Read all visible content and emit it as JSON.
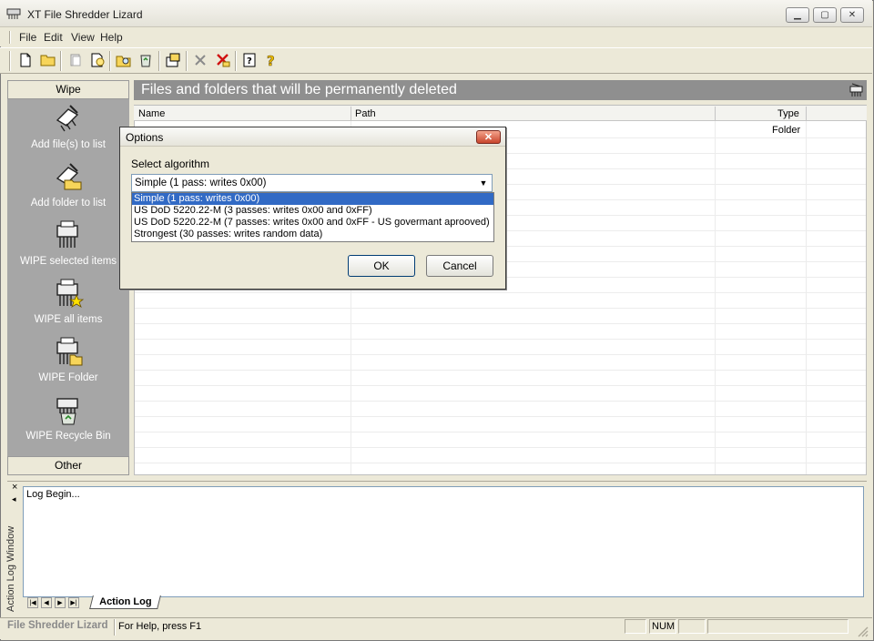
{
  "window": {
    "title": "XT File Shredder Lizard",
    "controls": {
      "minimize": "▁",
      "maximize": "▢",
      "close": "✕"
    }
  },
  "menu": [
    "File",
    "Edit",
    "View",
    "Help"
  ],
  "toolbar": {
    "icons": [
      "new-file-icon",
      "open-folder-icon",
      "copy-icon",
      "search-icon",
      "folder-search-icon",
      "recycle-icon",
      "properties-icon",
      "remove-icon",
      "remove-all-icon",
      "help-icon",
      "whats-this-icon"
    ]
  },
  "left_panel": {
    "header": "Wipe",
    "footer": "Other",
    "items": [
      {
        "label": "Add file(s) to list",
        "icon": "add-file-icon"
      },
      {
        "label": "Add folder to list",
        "icon": "add-folder-icon"
      },
      {
        "label": "WIPE selected items",
        "icon": "shredder-icon"
      },
      {
        "label": "WIPE all items",
        "icon": "shredder-star-icon"
      },
      {
        "label": "WIPE Folder",
        "icon": "shredder-folder-icon"
      },
      {
        "label": "WIPE Recycle Bin",
        "icon": "shredder-recycle-icon"
      }
    ]
  },
  "main": {
    "title": "Files and folders that will be permanently deleted",
    "columns": [
      "Name",
      "Path",
      "Type"
    ],
    "rows": [
      {
        "name": "",
        "path": "",
        "type": "Folder"
      }
    ]
  },
  "dialog": {
    "title": "Options",
    "close": "✕",
    "label": "Select algorithm",
    "selected": "Simple (1 pass: writes 0x00)",
    "options": [
      "Simple (1 pass: writes 0x00)",
      "US DoD 5220.22-M (3 passes: writes 0x00 and 0xFF)",
      "US DoD 5220.22-M (7 passes: writes 0x00 and 0xFF - US govermant aprooved)",
      "Strongest (30 passes: writes random data)"
    ],
    "ok": "OK",
    "cancel": "Cancel"
  },
  "log": {
    "text": "Log Begin...",
    "side_title": "Action Log Window",
    "tab": "Action Log",
    "close": "×",
    "pin": "◂"
  },
  "status": {
    "brand": "File Shredder Lizard",
    "help": "For Help, press F1",
    "num": "NUM"
  }
}
